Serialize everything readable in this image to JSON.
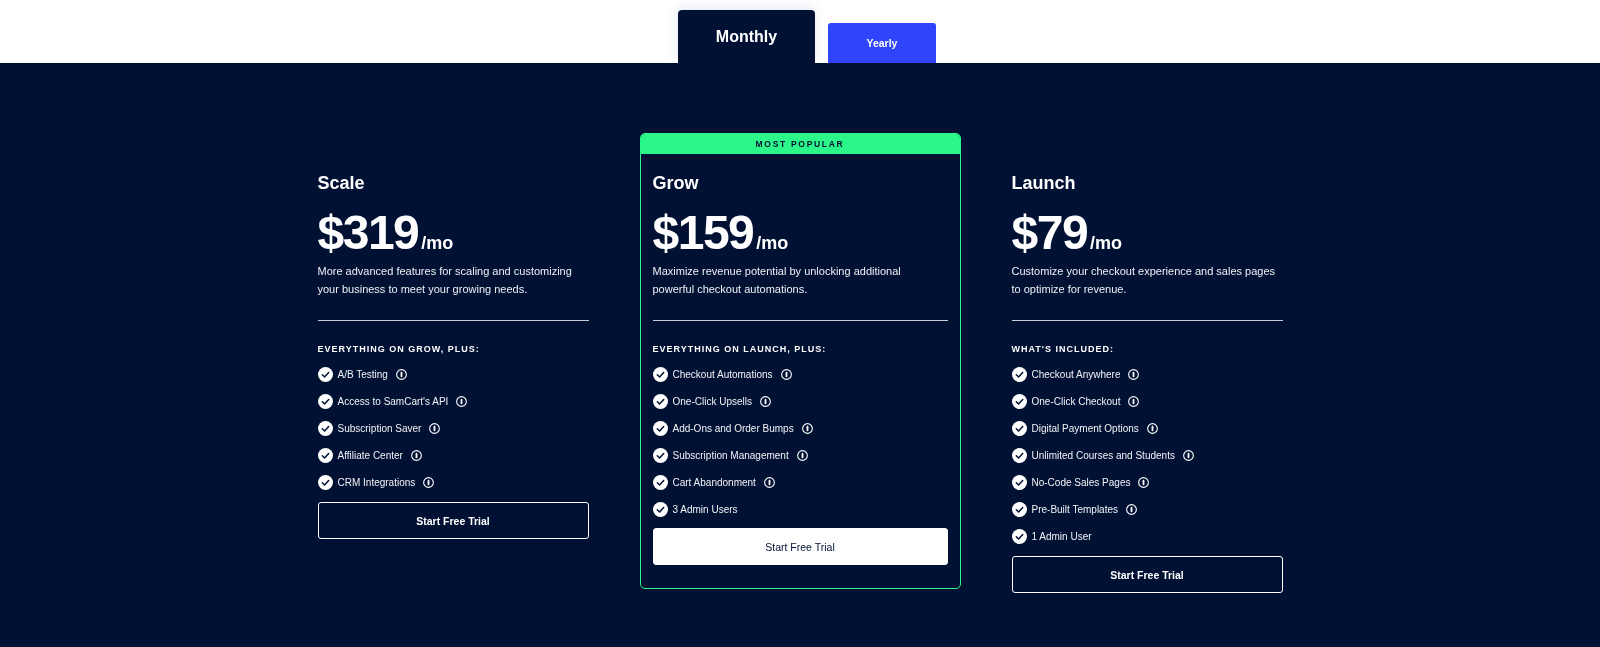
{
  "billing_tabs": [
    {
      "label": "Monthly",
      "selected": true
    },
    {
      "label": "Yearly",
      "selected": false
    }
  ],
  "plans": [
    {
      "name": "Scale",
      "price": "$319",
      "period": "/mo",
      "description": "More advanced features for scaling and customizing your business to meet your growing needs.",
      "features_heading": "EVERYTHING ON GROW, PLUS:",
      "features": [
        {
          "label": "A/B Testing",
          "has_info": true
        },
        {
          "label": "Access to SamCart's API",
          "has_info": true
        },
        {
          "label": "Subscription Saver",
          "has_info": true
        },
        {
          "label": "Affiliate Center",
          "has_info": true
        },
        {
          "label": "CRM Integrations",
          "has_info": true
        }
      ],
      "button": "Start Free Trial",
      "highlighted": false
    },
    {
      "badge": "MOST POPULAR",
      "name": "Grow",
      "price": "$159",
      "period": "/mo",
      "description": "Maximize revenue potential by unlocking additional powerful checkout automations.",
      "features_heading": "EVERYTHING ON LAUNCH, PLUS:",
      "features": [
        {
          "label": "Checkout Automations",
          "has_info": true
        },
        {
          "label": "One-Click Upsells",
          "has_info": true
        },
        {
          "label": "Add-Ons and Order Bumps",
          "has_info": true
        },
        {
          "label": "Subscription Management",
          "has_info": true
        },
        {
          "label": "Cart Abandonment",
          "has_info": true
        },
        {
          "label": "3 Admin Users",
          "has_info": false
        }
      ],
      "button": "Start Free Trial",
      "highlighted": true
    },
    {
      "name": "Launch",
      "price": "$79",
      "period": "/mo",
      "description": "Customize your checkout experience and sales pages to optimize for revenue.",
      "features_heading": "WHAT'S INCLUDED:",
      "features": [
        {
          "label": "Checkout Anywhere",
          "has_info": true
        },
        {
          "label": "One-Click Checkout",
          "has_info": true
        },
        {
          "label": "Digital Payment Options",
          "has_info": true
        },
        {
          "label": "Unlimited Courses and Students",
          "has_info": true
        },
        {
          "label": "No-Code Sales Pages",
          "has_info": true
        },
        {
          "label": "Pre-Built Templates",
          "has_info": true
        },
        {
          "label": "1 Admin User",
          "has_info": false
        }
      ],
      "button": "Start Free Trial",
      "highlighted": false
    }
  ]
}
